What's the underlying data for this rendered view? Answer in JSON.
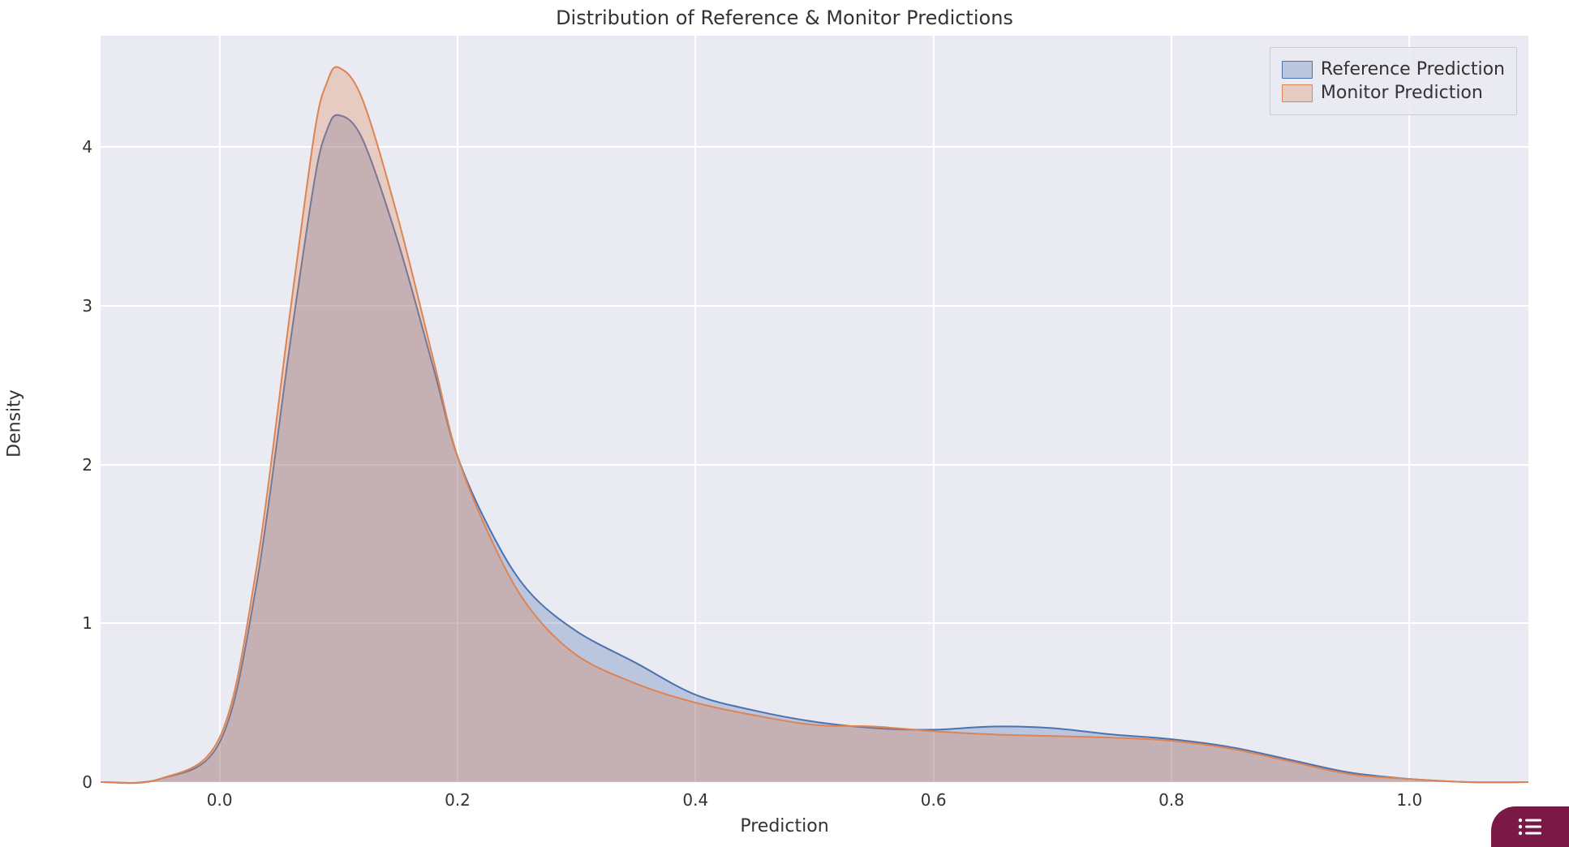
{
  "chart_data": {
    "type": "area",
    "title": "Distribution of Reference & Monitor Predictions",
    "xlabel": "Prediction",
    "ylabel": "Density",
    "xlim": [
      -0.1,
      1.1
    ],
    "ylim": [
      0,
      4.7
    ],
    "xticks": [
      0.0,
      0.2,
      0.4,
      0.6,
      0.8,
      1.0
    ],
    "yticks": [
      0,
      1,
      2,
      3,
      4
    ],
    "xtick_labels": [
      "0.0",
      "0.2",
      "0.4",
      "0.6",
      "0.8",
      "1.0"
    ],
    "ytick_labels": [
      "0",
      "1",
      "2",
      "3",
      "4"
    ],
    "legend_position": "upper right",
    "grid": true,
    "series": [
      {
        "name": "Reference Prediction",
        "stroke": "#4C72B0",
        "fill": "rgba(76,114,176,0.30)",
        "x": [
          -0.1,
          -0.05,
          0.0,
          0.03,
          0.06,
          0.08,
          0.09,
          0.1,
          0.12,
          0.15,
          0.18,
          0.2,
          0.23,
          0.26,
          0.3,
          0.35,
          0.4,
          0.45,
          0.5,
          0.55,
          0.6,
          0.65,
          0.7,
          0.75,
          0.8,
          0.85,
          0.9,
          0.95,
          1.0,
          1.05,
          1.1
        ],
        "values": [
          0.0,
          0.02,
          0.25,
          1.2,
          2.8,
          3.8,
          4.1,
          4.2,
          4.05,
          3.4,
          2.6,
          2.05,
          1.55,
          1.2,
          0.95,
          0.75,
          0.55,
          0.45,
          0.38,
          0.34,
          0.33,
          0.35,
          0.34,
          0.3,
          0.27,
          0.22,
          0.14,
          0.06,
          0.02,
          0.0,
          0.0
        ]
      },
      {
        "name": "Monitor Prediction",
        "stroke": "#DD8452",
        "fill": "rgba(221,132,82,0.30)",
        "x": [
          -0.1,
          -0.05,
          0.0,
          0.03,
          0.06,
          0.08,
          0.09,
          0.1,
          0.12,
          0.15,
          0.18,
          0.2,
          0.23,
          0.26,
          0.3,
          0.35,
          0.4,
          0.45,
          0.5,
          0.55,
          0.6,
          0.65,
          0.7,
          0.75,
          0.8,
          0.85,
          0.9,
          0.95,
          1.0,
          1.05,
          1.1
        ],
        "values": [
          0.0,
          0.02,
          0.28,
          1.3,
          3.0,
          4.1,
          4.4,
          4.5,
          4.3,
          3.55,
          2.65,
          2.05,
          1.5,
          1.1,
          0.8,
          0.62,
          0.5,
          0.42,
          0.36,
          0.35,
          0.32,
          0.3,
          0.29,
          0.28,
          0.26,
          0.21,
          0.13,
          0.05,
          0.02,
          0.0,
          0.0
        ]
      }
    ]
  },
  "fab": {
    "label": "toc"
  }
}
